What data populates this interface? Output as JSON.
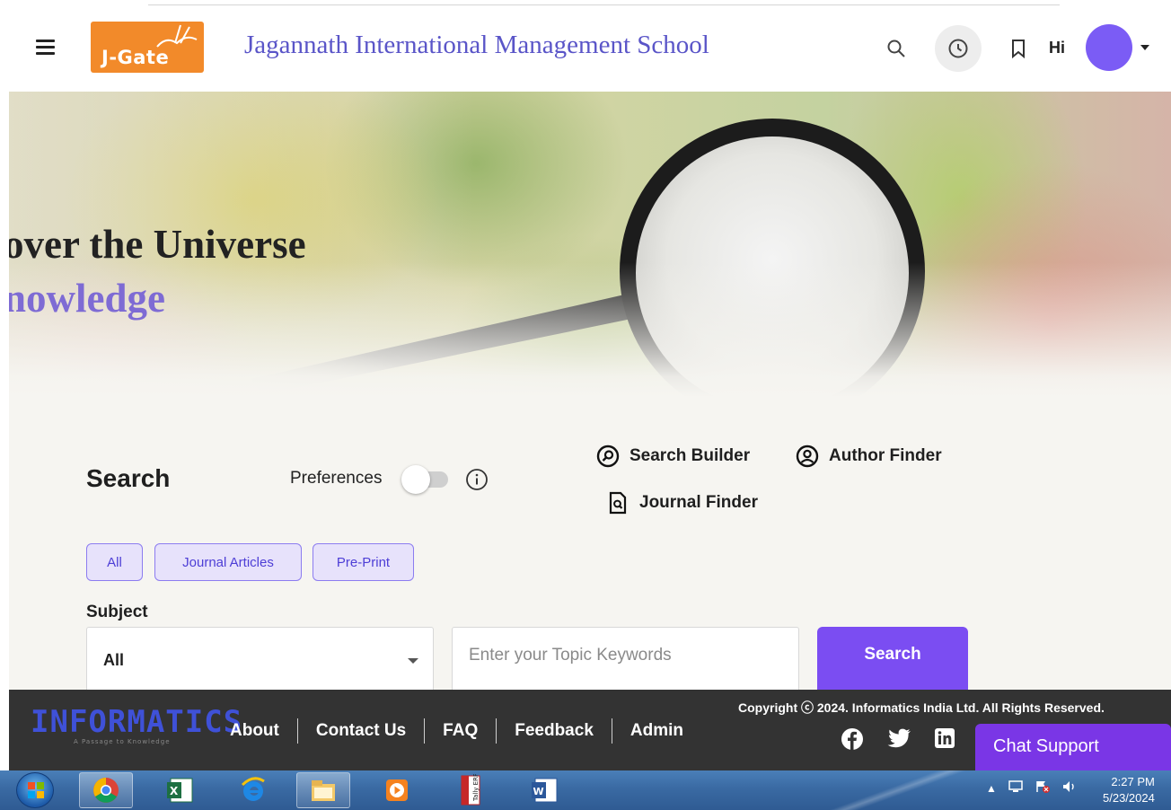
{
  "header": {
    "logo_text": "J-Gate",
    "institution": "Jagannath International Management School",
    "greeting": "Hi"
  },
  "hero": {
    "line1": "over the Universe",
    "line2": "nowledge"
  },
  "search": {
    "title": "Search",
    "preferences_label": "Preferences",
    "preferences_on": false,
    "tools": {
      "search_builder": "Search Builder",
      "author_finder": "Author Finder",
      "journal_finder": "Journal Finder"
    },
    "chips": [
      "All",
      "Journal Articles",
      "Pre-Print"
    ],
    "subject_label": "Subject",
    "subject_value": "All",
    "keyword_placeholder": "Enter your Topic Keywords",
    "search_button": "Search"
  },
  "footer": {
    "logo_text": "INFORMATICS",
    "logo_tagline": "A Passage to Knowledge",
    "nav": [
      "About",
      "Contact Us",
      "FAQ",
      "Feedback",
      "Admin"
    ],
    "copyright": "Copyright ⓒ 2024. Informatics India Ltd. All Rights Reserved.",
    "chat_support": "Chat Support"
  },
  "taskbar": {
    "apps": [
      "chrome-icon",
      "excel-icon",
      "ie-icon",
      "explorer-icon",
      "media-player-icon",
      "tally-erp9-icon",
      "word-icon"
    ],
    "tally_label": "Tally ERP 9",
    "time": "2:27 PM",
    "date": "5/23/2024"
  },
  "colors": {
    "brand_purple": "#5a55c8",
    "accent": "#7b4df2",
    "logo_orange": "#f28a2a",
    "footer_bg": "#333333",
    "chat_purple": "#7a36e6"
  }
}
